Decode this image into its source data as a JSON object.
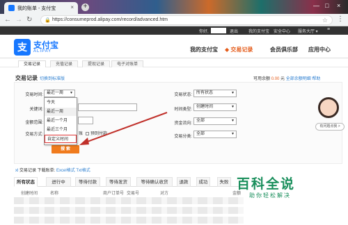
{
  "browser": {
    "tab_title": "我的账单 - 支付宝",
    "close_glyph": "×",
    "new_tab_glyph": "+",
    "url": "https://consumeprod.alipay.com/record/advanced.htm",
    "window_controls": [
      "—",
      "□",
      "×"
    ]
  },
  "topnav": {
    "greeting": "你好,",
    "logout": "退出",
    "my_alipay": "我的支付宝",
    "security": "安全中心",
    "service": "服务大厅 ▾"
  },
  "header": {
    "logo_glyph": "支",
    "logo_cn": "支付宝",
    "logo_en": "ALIPAY",
    "nav": [
      "我的支付宝",
      "交易记录",
      "会员俱乐部",
      "应用中心"
    ],
    "active_nav": "交易记录"
  },
  "subnav": [
    "交易记录",
    "充值记录",
    "提现记录",
    "电子对账单"
  ],
  "page": {
    "title": "交易记录",
    "switch_link": "切换到标准版",
    "avail_label": "可用余额",
    "avail_amount": "0.00",
    "avail_unit": "元",
    "full_balance_link": "全部余额明细",
    "help_link": "帮助"
  },
  "filters": {
    "trade_time_label": "交易时间:",
    "trade_time_value": "最近一周",
    "keyword_label": "关键词:",
    "amount_label": "金额范围:",
    "trade_method_label": "交易方式:",
    "trade_status_label": "交易状态:",
    "trade_status_value": "所有状态",
    "time_type_label": "时间类型:",
    "time_type_value": "创建时间",
    "fund_flow_label": "资金流向:",
    "fund_flow_value": "全部",
    "trade_category_label": "交易分类:",
    "trade_category_value": "全部",
    "checkbox1": "账",
    "checkbox2": "预到付款",
    "search_button": "搜 索"
  },
  "dropdown": {
    "options": [
      "今天",
      "最近一周",
      "最近一个月",
      "最近三个月",
      "自定义时间"
    ],
    "highlighted": "自定义时间"
  },
  "download": {
    "prefix": "xl",
    "text": "交易记录 下载账单:",
    "excel": "Excel格式",
    "txt": "Txt格式"
  },
  "result_tabs": [
    "所有状态",
    "进行中",
    "等待付款",
    "等待发货",
    "等待确认收货",
    "退款",
    "成功",
    "失败"
  ],
  "table_headers": [
    "创建时间",
    "名称",
    "商户订单号",
    "交易号",
    "对方",
    "金额"
  ],
  "assistant": {
    "bubble": "有问题点我 >"
  },
  "watermark": {
    "big": "百科全说",
    "small": "助你轻松解决"
  },
  "colors": {
    "brand_blue": "#1677ff",
    "accent_orange": "#f07b1d",
    "link_blue": "#2d7fd0",
    "highlight_red": "#d33333",
    "watermark_green": "#1a8f5c"
  }
}
